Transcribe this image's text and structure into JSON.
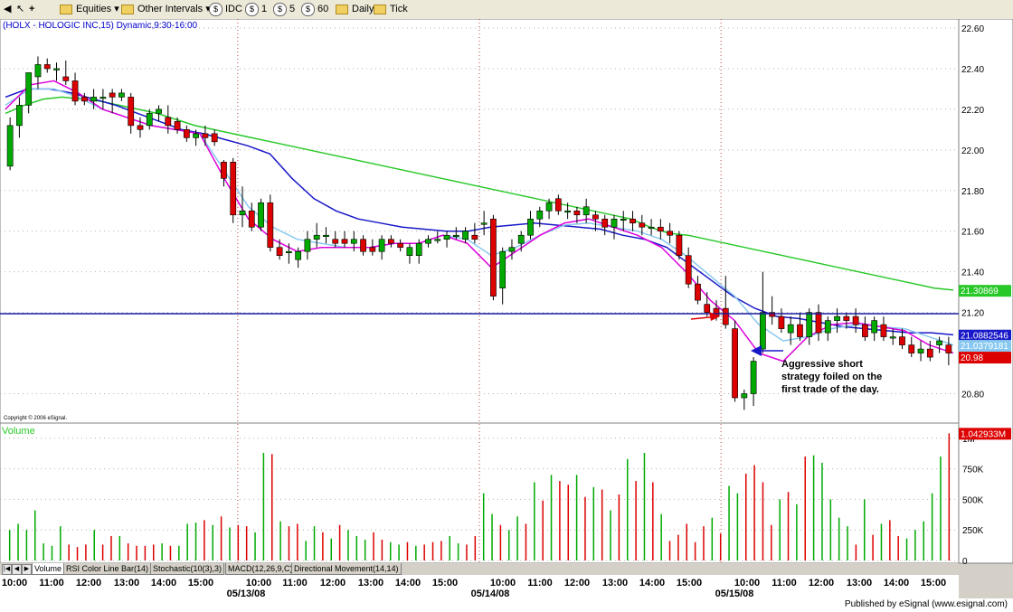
{
  "toolbar": {
    "items": [
      {
        "label": "Equities",
        "icon": "folder-icon"
      },
      {
        "label": "Other Intervals",
        "icon": "folder-icon"
      },
      {
        "label": "IDC",
        "icon": "dollar-icon"
      },
      {
        "label": "1",
        "icon": "dollar-icon"
      },
      {
        "label": "5",
        "icon": "dollar-icon"
      },
      {
        "label": "60",
        "icon": "dollar-icon"
      },
      {
        "label": "Daily",
        "icon": "folder-icon"
      },
      {
        "label": "Tick",
        "icon": "folder-icon"
      }
    ]
  },
  "chart_title": "(HOLX - HOLOGIC INC,15) Dynamic,9:30-16:00",
  "copyright": "Copyright © 2006 eSignal.",
  "annotation": "Aggressive short strategy foiled on the first trade of the day.",
  "volume_label": "Volume",
  "tabs": [
    "Volume",
    "RSI Color Line Bar(14)",
    "Stochastic(10(3),3)",
    "MACD(12,26,9,C)",
    "Directional Movement(14,14)"
  ],
  "footer": "Published by eSignal (www.esignal.com)",
  "colors": {
    "up": "#00aa00",
    "down": "#dd0000",
    "ma_fast": "#dd00dd",
    "ma_mid": "#88c8f0",
    "ma_slow": "#1818c8",
    "ma_long": "#28c828",
    "hline": "#1818a0"
  },
  "chart_data": {
    "type": "candlestick",
    "title": "(HOLX - HOLOGIC INC,15) Dynamic,9:30-16:00",
    "price_ticks": [
      "22.60",
      "22.40",
      "22.20",
      "22.00",
      "21.80",
      "21.60",
      "21.40",
      "21.20",
      "20.80"
    ],
    "price_range": [
      20.7,
      22.64
    ],
    "horizontal_line": 21.13,
    "price_labels": [
      {
        "text": "21.30869",
        "value": 21.30869,
        "color": "#28c828"
      },
      {
        "text": "21.0882546",
        "value": 21.0882546,
        "color": "#1818c8"
      },
      {
        "text": "21.0379181",
        "value": 21.0379181,
        "color": "#88c8f0"
      },
      {
        "text": "20.98",
        "value": 20.98,
        "color": "#dd0000"
      }
    ],
    "date_labels": [
      "05/13/08",
      "05/14/08",
      "05/15/08"
    ],
    "time_labels": [
      "10:00",
      "11:00",
      "12:00",
      "13:00",
      "14:00",
      "15:00",
      "10:00",
      "11:00",
      "12:00",
      "13:00",
      "14:00",
      "15:00",
      "10:00",
      "11:00",
      "12:00",
      "13:00",
      "14:00",
      "15:00",
      "10:00",
      "11:00",
      "12:00",
      "13:00",
      "14:00",
      "15:00"
    ],
    "candles": [
      [
        21.92,
        22.16,
        21.9,
        22.12
      ],
      [
        22.12,
        22.26,
        22.06,
        22.22
      ],
      [
        22.22,
        22.36,
        22.18,
        22.38
      ],
      [
        22.36,
        22.46,
        22.3,
        22.42
      ],
      [
        22.42,
        22.45,
        22.38,
        22.4
      ],
      [
        22.4,
        22.43,
        22.34,
        22.4
      ],
      [
        22.36,
        22.44,
        22.32,
        22.34
      ],
      [
        22.34,
        22.38,
        22.22,
        22.24
      ],
      [
        22.26,
        22.28,
        22.22,
        22.24
      ],
      [
        22.24,
        22.3,
        22.2,
        22.26
      ],
      [
        22.26,
        22.3,
        22.2,
        22.26
      ],
      [
        22.28,
        22.3,
        22.18,
        22.26
      ],
      [
        22.26,
        22.3,
        22.24,
        22.28
      ],
      [
        22.26,
        22.28,
        22.08,
        22.12
      ],
      [
        22.12,
        22.16,
        22.06,
        22.1
      ],
      [
        22.12,
        22.2,
        22.1,
        22.18
      ],
      [
        22.18,
        22.22,
        22.14,
        22.2
      ],
      [
        22.16,
        22.22,
        22.08,
        22.12
      ],
      [
        22.14,
        22.16,
        22.08,
        22.1
      ],
      [
        22.1,
        22.12,
        22.04,
        22.06
      ],
      [
        22.06,
        22.1,
        22.02,
        22.08
      ],
      [
        22.08,
        22.12,
        22.02,
        22.06
      ],
      [
        22.08,
        22.1,
        22.02,
        22.04
      ],
      [
        21.94,
        21.95,
        21.82,
        21.86
      ],
      [
        21.94,
        21.96,
        21.64,
        21.68
      ],
      [
        21.68,
        21.82,
        21.62,
        21.7
      ],
      [
        21.7,
        21.74,
        21.6,
        21.62
      ],
      [
        21.62,
        21.76,
        21.6,
        21.74
      ],
      [
        21.74,
        21.78,
        21.5,
        21.52
      ],
      [
        21.52,
        21.56,
        21.46,
        21.48
      ],
      [
        21.5,
        21.54,
        21.44,
        21.5
      ],
      [
        21.46,
        21.52,
        21.42,
        21.5
      ],
      [
        21.5,
        21.6,
        21.46,
        21.56
      ],
      [
        21.56,
        21.64,
        21.52,
        21.58
      ],
      [
        21.58,
        21.62,
        21.54,
        21.58
      ],
      [
        21.56,
        21.6,
        21.52,
        21.54
      ],
      [
        21.56,
        21.6,
        21.52,
        21.54
      ],
      [
        21.54,
        21.6,
        21.5,
        21.56
      ],
      [
        21.56,
        21.58,
        21.48,
        21.5
      ],
      [
        21.52,
        21.56,
        21.48,
        21.5
      ],
      [
        21.5,
        21.58,
        21.46,
        21.56
      ],
      [
        21.56,
        21.58,
        21.52,
        21.54
      ],
      [
        21.54,
        21.56,
        21.5,
        21.52
      ],
      [
        21.48,
        21.54,
        21.44,
        21.52
      ],
      [
        21.48,
        21.56,
        21.44,
        21.54
      ],
      [
        21.54,
        21.58,
        21.52,
        21.56
      ],
      [
        21.56,
        21.6,
        21.54,
        21.56
      ],
      [
        21.56,
        21.6,
        21.52,
        21.58
      ],
      [
        21.58,
        21.62,
        21.56,
        21.58
      ],
      [
        21.56,
        21.62,
        21.54,
        21.6
      ],
      [
        21.58,
        21.64,
        21.54,
        21.56
      ],
      [
        21.64,
        21.7,
        21.58,
        21.64
      ],
      [
        21.66,
        21.68,
        21.26,
        21.28
      ],
      [
        21.32,
        21.52,
        21.24,
        21.5
      ],
      [
        21.5,
        21.56,
        21.46,
        21.52
      ],
      [
        21.54,
        21.6,
        21.5,
        21.58
      ],
      [
        21.58,
        21.7,
        21.56,
        21.66
      ],
      [
        21.66,
        21.72,
        21.62,
        21.7
      ],
      [
        21.7,
        21.76,
        21.66,
        21.74
      ],
      [
        21.76,
        21.78,
        21.68,
        21.7
      ],
      [
        21.7,
        21.74,
        21.66,
        21.7
      ],
      [
        21.7,
        21.72,
        21.64,
        21.68
      ],
      [
        21.68,
        21.76,
        21.64,
        21.72
      ],
      [
        21.68,
        21.7,
        21.6,
        21.66
      ],
      [
        21.66,
        21.68,
        21.58,
        21.62
      ],
      [
        21.62,
        21.68,
        21.56,
        21.66
      ],
      [
        21.66,
        21.7,
        21.6,
        21.66
      ],
      [
        21.66,
        21.7,
        21.6,
        21.64
      ],
      [
        21.64,
        21.68,
        21.58,
        21.62
      ],
      [
        21.62,
        21.66,
        21.58,
        21.62
      ],
      [
        21.62,
        21.66,
        21.56,
        21.6
      ],
      [
        21.6,
        21.64,
        21.54,
        21.58
      ],
      [
        21.58,
        21.6,
        21.46,
        21.48
      ],
      [
        21.48,
        21.52,
        21.32,
        21.34
      ],
      [
        21.34,
        21.38,
        21.24,
        21.26
      ],
      [
        21.24,
        21.3,
        21.18,
        21.2
      ],
      [
        21.22,
        21.26,
        21.16,
        21.18
      ],
      [
        21.22,
        21.38,
        21.12,
        21.14
      ],
      [
        21.12,
        21.16,
        20.76,
        20.78
      ],
      [
        20.78,
        20.82,
        20.72,
        20.8
      ],
      [
        20.8,
        20.98,
        20.74,
        20.96
      ],
      [
        21.02,
        21.4,
        21.0,
        21.2
      ],
      [
        21.2,
        21.28,
        21.14,
        21.18
      ],
      [
        21.18,
        21.22,
        21.1,
        21.12
      ],
      [
        21.1,
        21.18,
        21.04,
        21.14
      ],
      [
        21.14,
        21.2,
        21.06,
        21.08
      ],
      [
        21.08,
        21.22,
        21.04,
        21.2
      ],
      [
        21.2,
        21.24,
        21.06,
        21.1
      ],
      [
        21.1,
        21.18,
        21.06,
        21.16
      ],
      [
        21.16,
        21.22,
        21.1,
        21.18
      ],
      [
        21.18,
        21.2,
        21.12,
        21.16
      ],
      [
        21.18,
        21.22,
        21.1,
        21.14
      ],
      [
        21.14,
        21.18,
        21.06,
        21.08
      ],
      [
        21.1,
        21.18,
        21.06,
        21.16
      ],
      [
        21.14,
        21.18,
        21.06,
        21.08
      ],
      [
        21.08,
        21.12,
        21.04,
        21.08
      ],
      [
        21.08,
        21.12,
        21.02,
        21.04
      ],
      [
        21.04,
        21.08,
        20.98,
        21.0
      ],
      [
        21.0,
        21.06,
        20.96,
        21.02
      ],
      [
        21.02,
        21.06,
        20.96,
        20.98
      ],
      [
        21.04,
        21.08,
        21.0,
        21.06
      ],
      [
        21.04,
        21.08,
        20.94,
        21.0
      ]
    ],
    "series": [
      {
        "name": "ma_long",
        "values": [
          22.18,
          22.22,
          22.25,
          22.26,
          22.25,
          22.24,
          22.22,
          22.2,
          22.18,
          22.15,
          22.12,
          22.1,
          22.08,
          22.06,
          22.04,
          22.02,
          22.0,
          21.98,
          21.96,
          21.94,
          21.92,
          21.9,
          21.88,
          21.86,
          21.84,
          21.82,
          21.8,
          21.78,
          21.76,
          21.74,
          21.72,
          21.7,
          21.68,
          21.66,
          21.62,
          21.59,
          21.58,
          21.56,
          21.54,
          21.52,
          21.5,
          21.48,
          21.46,
          21.44,
          21.42,
          21.4,
          21.38,
          21.36,
          21.34,
          21.32,
          21.31
        ]
      },
      {
        "name": "ma_slow",
        "values": [
          22.26,
          22.3,
          22.3,
          22.28,
          22.25,
          22.22,
          22.18,
          22.14,
          22.1,
          22.08,
          22.05,
          22.02,
          21.98,
          21.86,
          21.76,
          21.7,
          21.66,
          21.64,
          21.62,
          21.61,
          21.6,
          21.6,
          21.62,
          21.63,
          21.64,
          21.63,
          21.62,
          21.61,
          21.58,
          21.56,
          21.52,
          21.44,
          21.36,
          21.28,
          21.22,
          21.18,
          21.17,
          21.15,
          21.13,
          21.12,
          21.11,
          21.1,
          21.1,
          21.09
        ]
      },
      {
        "name": "ma_mid",
        "values": [
          22.22,
          22.3,
          22.3,
          22.26,
          22.2,
          22.16,
          22.12,
          22.1,
          22.08,
          21.9,
          21.72,
          21.62,
          21.56,
          21.54,
          21.52,
          21.52,
          21.54,
          21.54,
          21.58,
          21.56,
          21.48,
          21.52,
          21.58,
          21.63,
          21.64,
          21.62,
          21.6,
          21.56,
          21.48,
          21.38,
          21.28,
          21.14,
          21.06,
          21.08,
          21.12,
          21.14,
          21.13,
          21.12,
          21.08,
          21.04
        ]
      },
      {
        "name": "ma_fast",
        "values": [
          22.2,
          22.32,
          22.34,
          22.28,
          22.2,
          22.16,
          22.12,
          22.1,
          22.08,
          21.86,
          21.66,
          21.56,
          21.5,
          21.52,
          21.52,
          21.52,
          21.54,
          21.54,
          21.58,
          21.54,
          21.42,
          21.5,
          21.58,
          21.64,
          21.66,
          21.62,
          21.58,
          21.52,
          21.4,
          21.26,
          21.16,
          21.0,
          20.96,
          21.08,
          21.14,
          21.15,
          21.13,
          21.11,
          21.04,
          21.0
        ]
      }
    ],
    "volume": {
      "label": "Volume",
      "ticks": [
        "1M",
        "750K",
        "500K",
        "250K",
        "0"
      ],
      "range": [
        0,
        1050000
      ],
      "last_label": "1.042933M",
      "values": [
        [
          250000,
          1
        ],
        [
          300000,
          1
        ],
        [
          250000,
          1
        ],
        [
          410000,
          1
        ],
        [
          140000,
          1
        ],
        [
          120000,
          1
        ],
        [
          280000,
          1
        ],
        [
          130000,
          0
        ],
        [
          110000,
          0
        ],
        [
          130000,
          0
        ],
        [
          250000,
          1
        ],
        [
          130000,
          0
        ],
        [
          200000,
          0
        ],
        [
          200000,
          1
        ],
        [
          140000,
          0
        ],
        [
          120000,
          0
        ],
        [
          120000,
          0
        ],
        [
          130000,
          0
        ],
        [
          140000,
          1
        ],
        [
          120000,
          0
        ],
        [
          120000,
          1
        ],
        [
          300000,
          1
        ],
        [
          310000,
          1
        ],
        [
          330000,
          0
        ],
        [
          290000,
          1
        ],
        [
          360000,
          0
        ],
        [
          270000,
          1
        ],
        [
          290000,
          0
        ],
        [
          280000,
          0
        ],
        [
          230000,
          1
        ],
        [
          880000,
          1
        ],
        [
          870000,
          0
        ],
        [
          320000,
          1
        ],
        [
          280000,
          0
        ],
        [
          300000,
          0
        ],
        [
          160000,
          1
        ],
        [
          280000,
          1
        ],
        [
          230000,
          0
        ],
        [
          180000,
          1
        ],
        [
          290000,
          0
        ],
        [
          250000,
          1
        ],
        [
          200000,
          1
        ],
        [
          170000,
          1
        ],
        [
          230000,
          0
        ],
        [
          170000,
          0
        ],
        [
          150000,
          1
        ],
        [
          130000,
          1
        ],
        [
          150000,
          0
        ],
        [
          120000,
          1
        ],
        [
          130000,
          0
        ],
        [
          150000,
          0
        ],
        [
          160000,
          0
        ],
        [
          200000,
          1
        ],
        [
          140000,
          1
        ],
        [
          130000,
          0
        ],
        [
          200000,
          0
        ],
        [
          550000,
          1
        ],
        [
          380000,
          1
        ],
        [
          290000,
          0
        ],
        [
          250000,
          1
        ],
        [
          360000,
          1
        ],
        [
          300000,
          0
        ],
        [
          640000,
          1
        ],
        [
          490000,
          0
        ],
        [
          700000,
          1
        ],
        [
          650000,
          0
        ],
        [
          620000,
          0
        ],
        [
          700000,
          1
        ],
        [
          520000,
          0
        ],
        [
          600000,
          1
        ],
        [
          580000,
          0
        ],
        [
          410000,
          1
        ],
        [
          540000,
          0
        ],
        [
          830000,
          1
        ],
        [
          650000,
          0
        ],
        [
          880000,
          1
        ],
        [
          640000,
          0
        ],
        [
          380000,
          1
        ],
        [
          160000,
          0
        ],
        [
          210000,
          0
        ],
        [
          300000,
          0
        ],
        [
          150000,
          0
        ],
        [
          280000,
          0
        ],
        [
          350000,
          1
        ],
        [
          220000,
          0
        ],
        [
          610000,
          1
        ],
        [
          550000,
          1
        ],
        [
          710000,
          0
        ],
        [
          780000,
          0
        ],
        [
          640000,
          0
        ],
        [
          290000,
          0
        ],
        [
          500000,
          1
        ],
        [
          560000,
          0
        ],
        [
          460000,
          1
        ],
        [
          850000,
          0
        ],
        [
          860000,
          1
        ],
        [
          800000,
          1
        ],
        [
          500000,
          1
        ],
        [
          350000,
          1
        ],
        [
          280000,
          1
        ],
        [
          130000,
          0
        ],
        [
          500000,
          1
        ],
        [
          210000,
          0
        ],
        [
          300000,
          1
        ],
        [
          330000,
          0
        ],
        [
          200000,
          0
        ],
        [
          180000,
          1
        ],
        [
          250000,
          1
        ],
        [
          320000,
          1
        ],
        [
          550000,
          1
        ],
        [
          850000,
          1
        ],
        [
          1040000,
          0
        ]
      ]
    }
  }
}
